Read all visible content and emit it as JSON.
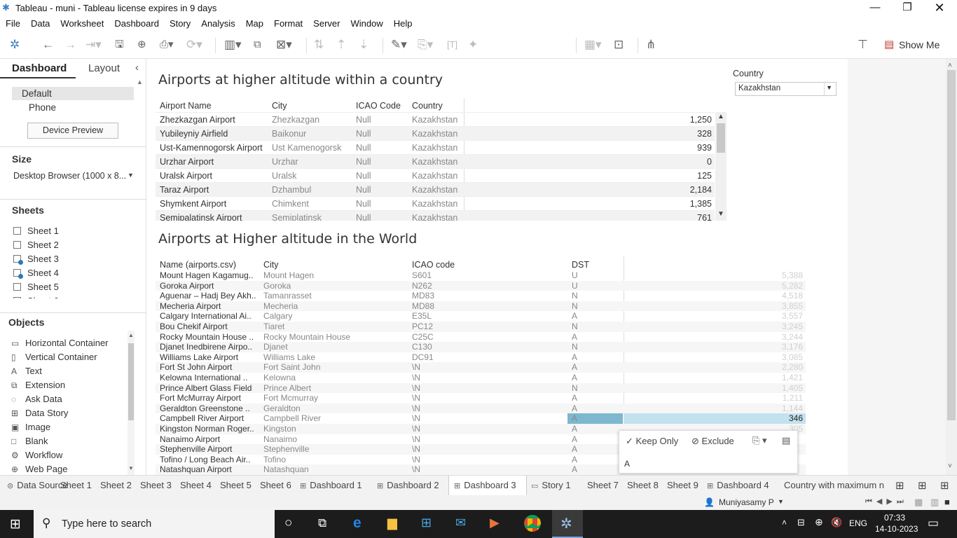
{
  "window": {
    "title": "Tableau - muni - Tableau license expires in 9 days"
  },
  "menu": [
    "File",
    "Data",
    "Worksheet",
    "Dashboard",
    "Story",
    "Analysis",
    "Map",
    "Format",
    "Server",
    "Window",
    "Help"
  ],
  "toolbar": {
    "show_me": "Show Me"
  },
  "left_panel": {
    "tab_dashboard": "Dashboard",
    "tab_layout": "Layout",
    "devices": [
      "Default",
      "Phone"
    ],
    "device_preview": "Device Preview",
    "size_label": "Size",
    "size_value": "Desktop Browser (1000 x 8...",
    "sheets_label": "Sheets",
    "sheets": [
      "Sheet 1",
      "Sheet 2",
      "Sheet 3",
      "Sheet 4",
      "Sheet 5",
      "Sheet 6"
    ],
    "objects_label": "Objects",
    "objects": [
      {
        "icon": "horizontal-container-icon",
        "label": "Horizontal Container"
      },
      {
        "icon": "vertical-container-icon",
        "label": "Vertical Container"
      },
      {
        "icon": "text-icon",
        "label": "Text"
      },
      {
        "icon": "extension-icon",
        "label": "Extension"
      },
      {
        "icon": "ask-data-icon",
        "label": "Ask Data"
      },
      {
        "icon": "data-story-icon",
        "label": "Data Story"
      },
      {
        "icon": "image-icon",
        "label": "Image"
      },
      {
        "icon": "blank-icon",
        "label": "Blank"
      },
      {
        "icon": "workflow-icon",
        "label": "Workflow"
      },
      {
        "icon": "web-page-icon",
        "label": "Web Page"
      }
    ]
  },
  "filter": {
    "label": "Country",
    "value": "Kazakhstan"
  },
  "table1": {
    "title": "Airports at higher altitude within a country",
    "headers": [
      "Airport Name",
      "City",
      "ICAO Code",
      "Country"
    ],
    "rows": [
      [
        "Zhezkazgan Airport",
        "Zhezkazgan",
        "Null",
        "Kazakhstan",
        "1,250"
      ],
      [
        "Yubileyniy Airfield",
        "Baikonur",
        "Null",
        "Kazakhstan",
        "328"
      ],
      [
        "Ust-Kamennogorsk Airport",
        "Ust Kamenogorsk",
        "Null",
        "Kazakhstan",
        "939"
      ],
      [
        "Urzhar Airport",
        "Urzhar",
        "Null",
        "Kazakhstan",
        "0"
      ],
      [
        "Uralsk Airport",
        "Uralsk",
        "Null",
        "Kazakhstan",
        "125"
      ],
      [
        "Taraz Airport",
        "Dzhambul",
        "Null",
        "Kazakhstan",
        "2,184"
      ],
      [
        "Shymkent Airport",
        "Chimkent",
        "Null",
        "Kazakhstan",
        "1,385"
      ],
      [
        "Semipalatinsk Airport",
        "Semiplatinsk",
        "Null",
        "Kazakhstan",
        "761"
      ]
    ]
  },
  "table2": {
    "title": "Airports at Higher altitude in the World",
    "headers": [
      "Name (airports.csv)",
      "City",
      "ICAO code",
      "DST"
    ],
    "rows": [
      [
        "Mount Hagen Kagamug..",
        "Mount Hagen",
        "S601",
        "U",
        "5,388"
      ],
      [
        "Goroka Airport",
        "Goroka",
        "N262",
        "U",
        "5,282"
      ],
      [
        "Aguenar – Hadj Bey Akh..",
        "Tamanrasset",
        "MD83",
        "N",
        "4,518"
      ],
      [
        "Mecheria Airport",
        "Mecheria",
        "MD88",
        "N",
        "3,855"
      ],
      [
        "Calgary International Ai..",
        "Calgary",
        "E35L",
        "A",
        "3,557"
      ],
      [
        "Bou Chekif Airport",
        "Tiaret",
        "PC12",
        "N",
        "3,245"
      ],
      [
        "Rocky Mountain House ..",
        "Rocky Mountain House",
        "C25C",
        "A",
        "3,244"
      ],
      [
        "Djanet Inedbirene Airpo..",
        "Djanet",
        "C130",
        "N",
        "3,176"
      ],
      [
        "Williams Lake Airport",
        "Williams Lake",
        "DC91",
        "A",
        "3,085"
      ],
      [
        "Fort St John Airport",
        "Fort Saint John",
        "\\N",
        "A",
        "2,280"
      ],
      [
        "Kelowna International ..",
        "Kelowna",
        "\\N",
        "A",
        "1,421"
      ],
      [
        "Prince Albert Glass Field",
        "Prince Albert",
        "\\N",
        "N",
        "1,405"
      ],
      [
        "Fort McMurray Airport",
        "Fort Mcmurray",
        "\\N",
        "A",
        "1,211"
      ],
      [
        "Geraldton Greenstone ..",
        "Geraldton",
        "\\N",
        "A",
        "1,144"
      ],
      [
        "Campbell River Airport",
        "Campbell River",
        "\\N",
        "A",
        "346"
      ],
      [
        "Kingston Norman Roger..",
        "Kingston",
        "\\N",
        "A",
        "305"
      ],
      [
        "Nanaimo Airport",
        "Nanaimo",
        "\\N",
        "A",
        ""
      ],
      [
        "Stephenville Airport",
        "Stephenville",
        "\\N",
        "A",
        ""
      ],
      [
        "Tofino / Long Beach Air..",
        "Tofino",
        "\\N",
        "A",
        ""
      ],
      [
        "Natashquan Airport",
        "Natashquan",
        "\\N",
        "A",
        ""
      ]
    ],
    "selected_row": 14
  },
  "tooltip": {
    "keep_only": "Keep Only",
    "exclude": "Exclude",
    "value": "A"
  },
  "tabs": [
    "Data Source",
    "Sheet 1",
    "Sheet 2",
    "Sheet 3",
    "Sheet 4",
    "Sheet 5",
    "Sheet 6",
    "Dashboard 1",
    "Dashboard 2",
    "Dashboard 3",
    "Story 1",
    "Sheet 7",
    "Sheet 8",
    "Sheet 9",
    "Dashboard 4",
    "Country with maximum n"
  ],
  "active_tab": "Dashboard 3",
  "status": {
    "user": "Muniyasamy P"
  },
  "taskbar": {
    "search_placeholder": "Type here to search",
    "lang": "ENG",
    "time": "07:33",
    "date": "14-10-2023"
  }
}
